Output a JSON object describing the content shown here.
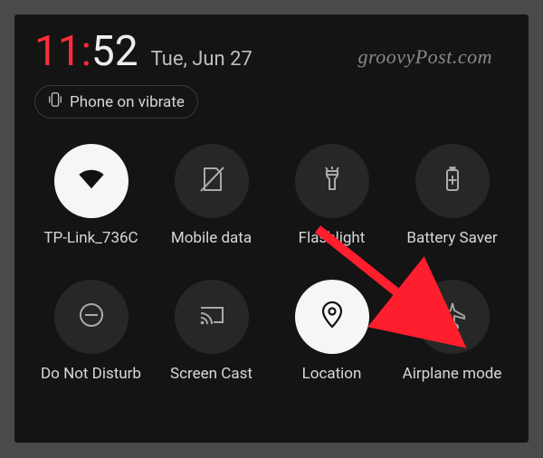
{
  "watermark": "groovyPost.com",
  "clock": {
    "hours": "11",
    "minutes": "52"
  },
  "date": "Tue, Jun 27",
  "vibrate_chip": "Phone on vibrate",
  "tiles": {
    "wifi": {
      "label": "TP-Link_736C",
      "active": true
    },
    "mobiledata": {
      "label": "Mobile data",
      "active": false
    },
    "flashlight": {
      "label": "Flashlight",
      "active": false
    },
    "battery": {
      "label": "Battery Saver",
      "active": false
    },
    "dnd": {
      "label": "Do Not Disturb",
      "active": false
    },
    "cast": {
      "label": "Screen Cast",
      "active": false
    },
    "location": {
      "label": "Location",
      "active": true
    },
    "airplane": {
      "label": "Airplane mode",
      "active": false
    }
  },
  "annotation": {
    "arrow_color": "#ff1e2d",
    "target": "airplane"
  }
}
